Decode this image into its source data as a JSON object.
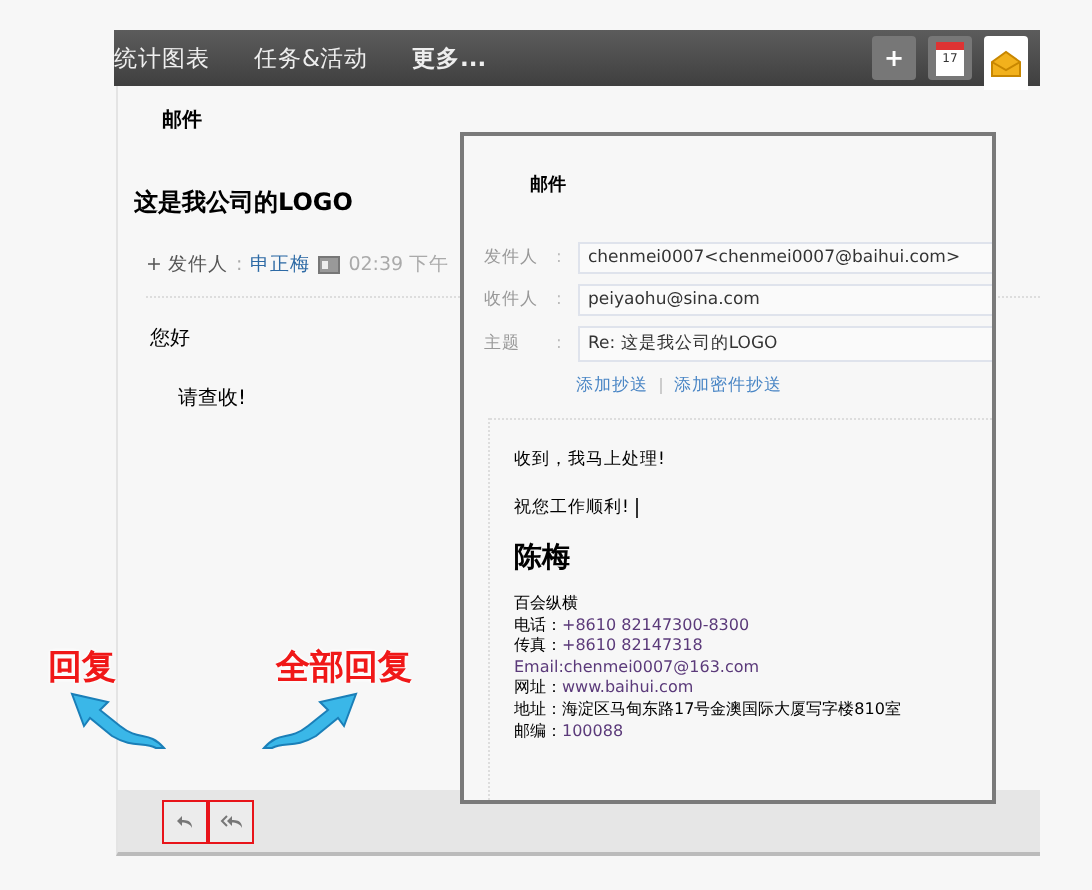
{
  "nav": {
    "items": [
      "统计图表",
      "任务&活动",
      "更多..."
    ],
    "tools": [
      {
        "kind": "add",
        "label": "+",
        "selected": false
      },
      {
        "kind": "calendar",
        "label": "17",
        "selected": false
      },
      {
        "kind": "mail",
        "selected": true
      }
    ]
  },
  "mail": {
    "heading": "邮件",
    "subject": "这是我公司的LOGO",
    "sender_label": "+ 发件人",
    "sender_sep": ":",
    "sender": "申正梅",
    "time": "02:39 下午",
    "body": [
      "您好",
      "请查收!"
    ]
  },
  "popup": {
    "heading": "邮件",
    "fields": [
      {
        "label": "发件人",
        "sep": ":",
        "value": "chenmei0007<chenmei0007@baihui.com>"
      },
      {
        "label": "收件人",
        "sep": ":",
        "value": "peiyaohu@sina.com"
      },
      {
        "label": "主题",
        "sep": ":",
        "value": "Re: 这是我公司的LOGO"
      }
    ],
    "links": [
      "添加抄送",
      "添加密件抄送"
    ],
    "body": [
      "收到，我马上处理!",
      "祝您工作顺利!"
    ],
    "signature": {
      "name": "陈梅",
      "lines": [
        {
          "label": "百会纵横"
        },
        {
          "label": "电话：",
          "value": "+8610 82147300-8300"
        },
        {
          "label": "传真：",
          "value": "+8610 82147318"
        },
        {
          "value": "Email:chenmei0007@163.com"
        },
        {
          "label": "网址：",
          "value": "www.baihui.com"
        },
        {
          "label": "地址：海淀区马甸东路17号金澳国际大厦写字楼810室"
        },
        {
          "label": "邮编：",
          "value": "100088"
        }
      ]
    }
  },
  "toolbar": {
    "buttons": [
      {
        "kind": "reply",
        "highlighted": true
      },
      {
        "kind": "reply-all",
        "highlighted": true
      }
    ]
  },
  "annotations": [
    {
      "text": "回复"
    },
    {
      "text": "全部回复"
    }
  ]
}
